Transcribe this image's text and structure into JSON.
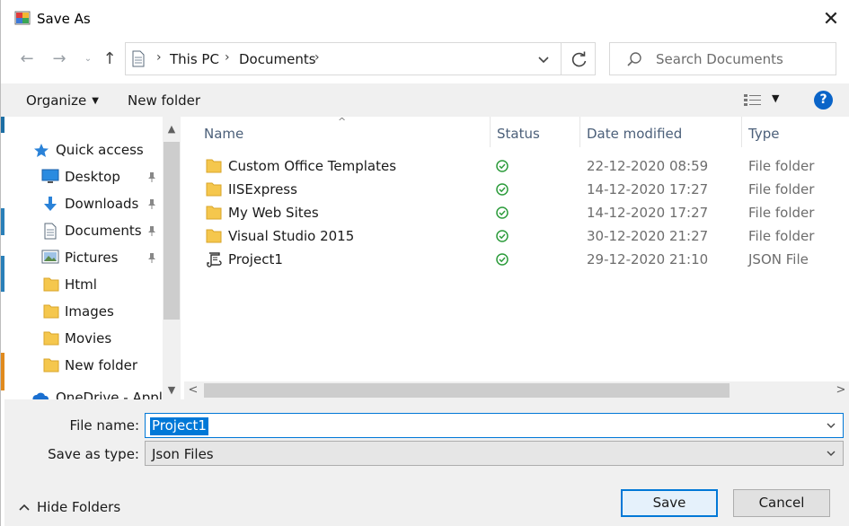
{
  "window": {
    "title": "Save As"
  },
  "address": {
    "crumbs": [
      "This PC",
      "Documents"
    ]
  },
  "search": {
    "placeholder": "Search Documents"
  },
  "toolbar": {
    "organize_label": "Organize",
    "new_folder_label": "New folder",
    "help_label": "?"
  },
  "nav": {
    "items": [
      {
        "label": "Quick access",
        "icon": "star-icon"
      },
      {
        "label": "Desktop",
        "icon": "desktop-icon",
        "pinned": true
      },
      {
        "label": "Downloads",
        "icon": "download-arrow-icon",
        "pinned": true
      },
      {
        "label": "Documents",
        "icon": "document-icon",
        "pinned": true
      },
      {
        "label": "Pictures",
        "icon": "pictures-icon",
        "pinned": true
      },
      {
        "label": "Html",
        "icon": "folder-icon"
      },
      {
        "label": "Images",
        "icon": "folder-icon"
      },
      {
        "label": "Movies",
        "icon": "folder-icon"
      },
      {
        "label": "New folder",
        "icon": "folder-icon"
      },
      {
        "label": "OneDrive - Appli",
        "icon": "cloud-icon"
      }
    ]
  },
  "files": {
    "columns": [
      "Name",
      "Status",
      "Date modified",
      "Type"
    ],
    "rows": [
      {
        "name": "Custom Office Templates",
        "date": "22-12-2020 08:59",
        "type": "File folder",
        "icon": "folder-icon"
      },
      {
        "name": "IISExpress",
        "date": "14-12-2020 17:27",
        "type": "File folder",
        "icon": "folder-icon"
      },
      {
        "name": "My Web Sites",
        "date": "14-12-2020 17:27",
        "type": "File folder",
        "icon": "folder-icon"
      },
      {
        "name": "Visual Studio 2015",
        "date": "30-12-2020 21:27",
        "type": "File folder",
        "icon": "folder-icon"
      },
      {
        "name": "Project1",
        "date": "29-12-2020 21:10",
        "type": "JSON File",
        "icon": "json-file-icon"
      }
    ]
  },
  "form": {
    "file_name_label": "File name:",
    "file_name_value": "Project1",
    "save_type_label": "Save as type:",
    "save_type_value": "Json Files"
  },
  "footer": {
    "hide_folders_label": "Hide Folders",
    "save_label": "Save",
    "cancel_label": "Cancel"
  },
  "colors": {
    "accent": "#0078d7",
    "folder": "#f5c74d",
    "sync_ok": "#2d9c3c",
    "help": "#0a64c8"
  }
}
